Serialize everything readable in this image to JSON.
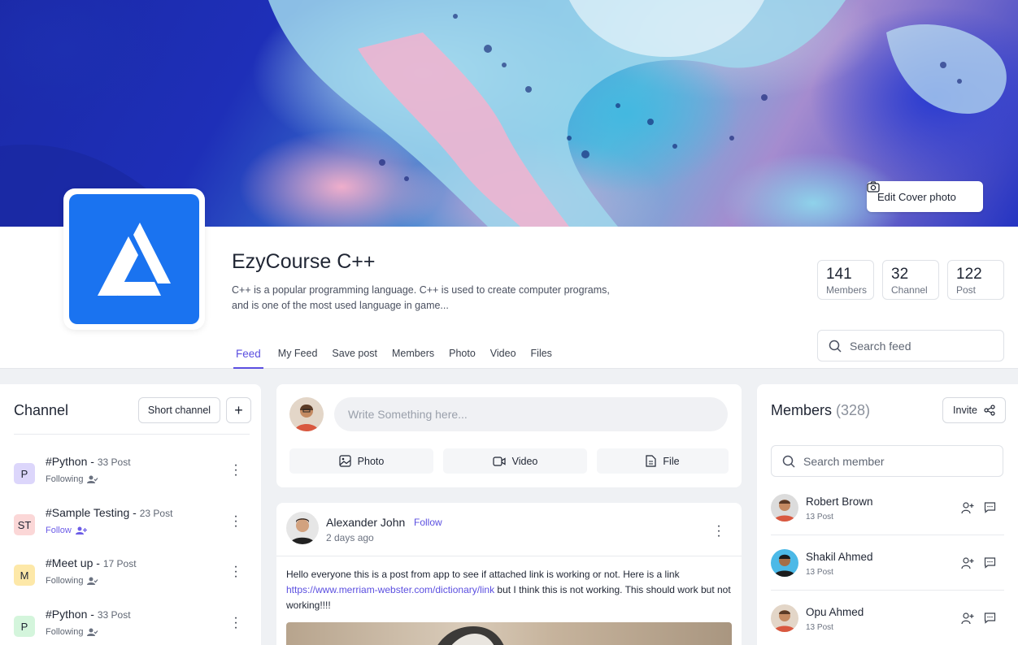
{
  "cover": {
    "edit_label": "Edit Cover photo"
  },
  "group": {
    "name": "EzyCourse C++",
    "description": "C++ is a popular programming language. C++ is used to create computer programs, and is one of the most used language in game..."
  },
  "stats": [
    {
      "value": "141",
      "label": "Members"
    },
    {
      "value": "32",
      "label": "Channel"
    },
    {
      "value": "122",
      "label": "Post"
    }
  ],
  "search_feed": {
    "placeholder": "Search feed"
  },
  "tabs": [
    "Feed",
    "My Feed",
    "Save post",
    "Members",
    "Photo",
    "Video",
    "Files"
  ],
  "active_tab": "Feed",
  "channel": {
    "title": "Channel",
    "short_label": "Short channel",
    "add_label": "+",
    "items": [
      {
        "initials": "P",
        "name": "#Python - ",
        "posts": "33 Post",
        "status": "Following",
        "bg": "#dcd6fb"
      },
      {
        "initials": "ST",
        "name": "#Sample Testing - ",
        "posts": "23 Post",
        "status": "Follow",
        "bg": "#fbd7d7"
      },
      {
        "initials": "M",
        "name": "#Meet up - ",
        "posts": "17 Post",
        "status": "Following",
        "bg": "#fde8a8"
      },
      {
        "initials": "P",
        "name": "#Python - ",
        "posts": "33 Post",
        "status": "Following",
        "bg": "#d4f5dc"
      }
    ]
  },
  "composer": {
    "placeholder": "Write Something here...",
    "photo": "Photo",
    "video": "Video",
    "file": "File"
  },
  "post": {
    "author": "Alexander John",
    "follow": "Follow",
    "time": "2 days ago",
    "text_before": "Hello everyone   this is a post from app to see if attached link is working or not. Here is a link ",
    "link": "https://www.merriam-webster.com/dictionary/link",
    "text_after": "  but I think this is not working. This should work but not working!!!!"
  },
  "members": {
    "title": "Members",
    "count": "(328)",
    "invite": "Invite",
    "search_placeholder": "Search member",
    "list": [
      {
        "name": "Robert Brown",
        "posts": "13 Post"
      },
      {
        "name": "Shakil Ahmed",
        "posts": "13 Post"
      },
      {
        "name": "Opu Ahmed",
        "posts": "13 Post"
      }
    ]
  },
  "colors": {
    "accent": "#5b4fe0",
    "logo_bg": "#1a73f0"
  }
}
